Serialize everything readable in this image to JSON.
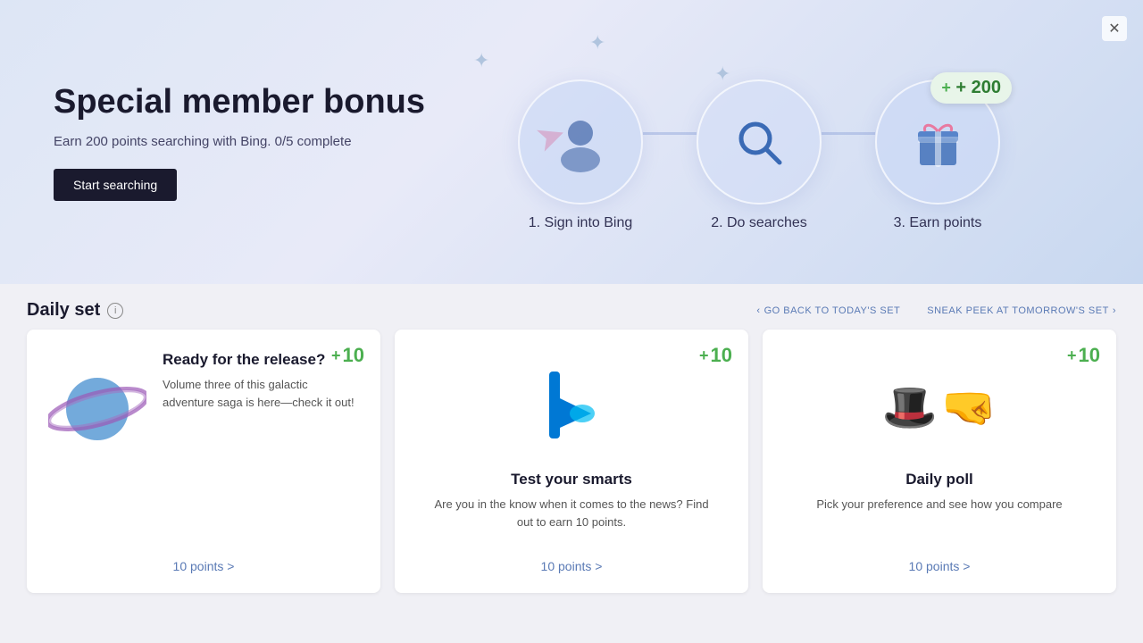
{
  "banner": {
    "title": "Special member bonus",
    "subtitle": "Earn 200 points searching with Bing. 0/5 complete",
    "start_button": "Start searching",
    "close_icon": "✕",
    "steps": [
      {
        "id": "step1",
        "icon": "👤",
        "label": "1. Sign into Bing",
        "has_badge": false
      },
      {
        "id": "step2",
        "icon": "🔍",
        "label": "2. Do searches",
        "has_badge": false
      },
      {
        "id": "step3",
        "icon": "🎁",
        "label": "3. Earn points",
        "has_badge": true,
        "badge_text": "+ 200"
      }
    ]
  },
  "daily_set": {
    "title": "Daily set",
    "nav_back": "GO BACK TO TODAY'S SET",
    "nav_forward": "SNEAK PEEK AT TOMORROW'S SET",
    "cards": [
      {
        "id": "card1",
        "points": "+",
        "points_value": "10",
        "title": "Ready for the release?",
        "description": "Volume three of this galactic adventure saga is here—check it out!",
        "link": "10 points >"
      },
      {
        "id": "card2",
        "points": "+",
        "points_value": "10",
        "title": "Test your smarts",
        "description": "Are you in the know when it comes to the news? Find out to earn 10 points.",
        "link": "10 points >"
      },
      {
        "id": "card3",
        "points": "+",
        "points_value": "10",
        "title": "Daily poll",
        "description": "Pick your preference and see how you compare",
        "link": "10 points >"
      }
    ]
  },
  "colors": {
    "accent_blue": "#5a7ab5",
    "accent_green": "#4caf50",
    "dark": "#1a1a2e",
    "text_muted": "#555"
  }
}
